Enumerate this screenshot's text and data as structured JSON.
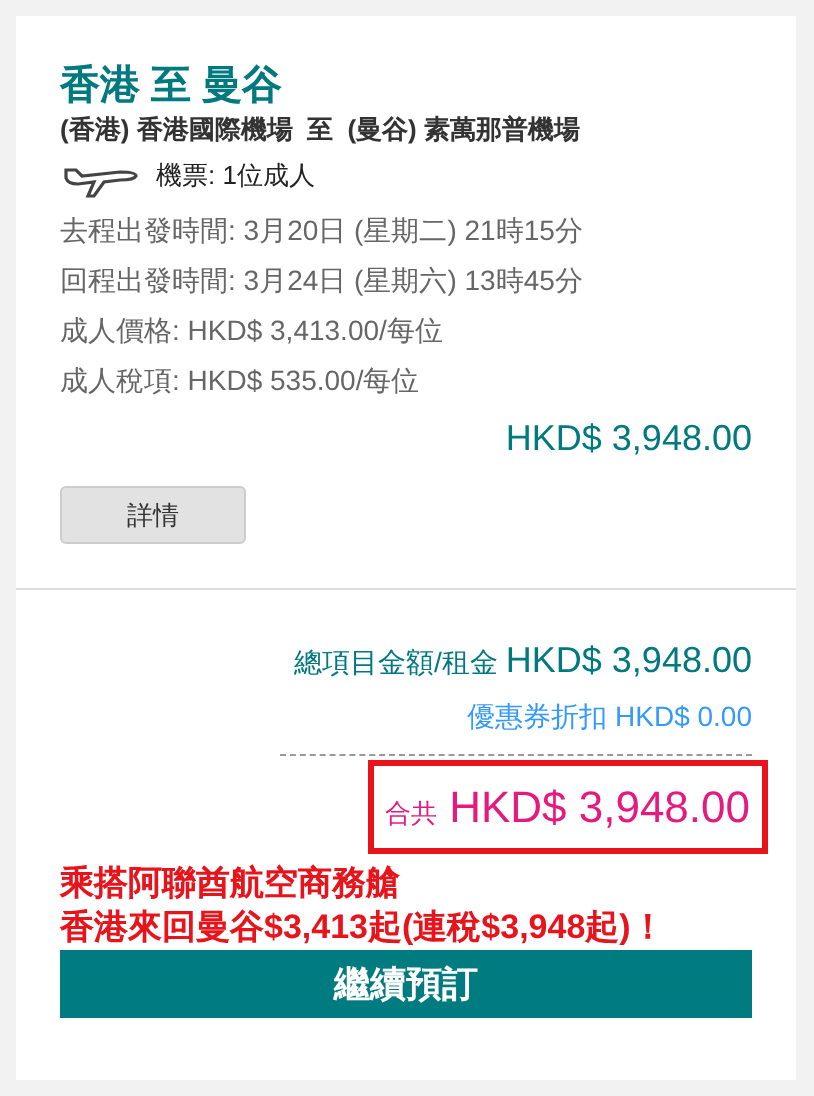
{
  "route_title": "香港 至 曼谷",
  "airports": "(香港) 香港國際機場  至  (曼谷) 素萬那普機場",
  "tickets": "機票: 1位成人",
  "details": [
    {
      "text": "去程出發時間: 3月20日 (星期二) 21時15分"
    },
    {
      "text": "回程出發時間: 3月24日 (星期六) 13時45分"
    },
    {
      "text": "成人價格: HKD$ 3,413.00/每位"
    },
    {
      "text": "成人稅項: HKD$ 535.00/每位"
    }
  ],
  "subtotal": "HKD$ 3,948.00",
  "details_button": "詳情",
  "summary": {
    "fare_label": "總項目金額/租金",
    "fare_amount": "HKD$ 3,948.00",
    "coupon": "優惠券折扣 HKD$ 0.00",
    "total_label": "合共",
    "total_amount": "HKD$ 3,948.00"
  },
  "promo_lines": [
    "乘搭阿聯酋航空商務艙",
    "香港來回曼谷$3,413起(連稅$3,948起)！"
  ],
  "continue_button": "繼續預訂"
}
